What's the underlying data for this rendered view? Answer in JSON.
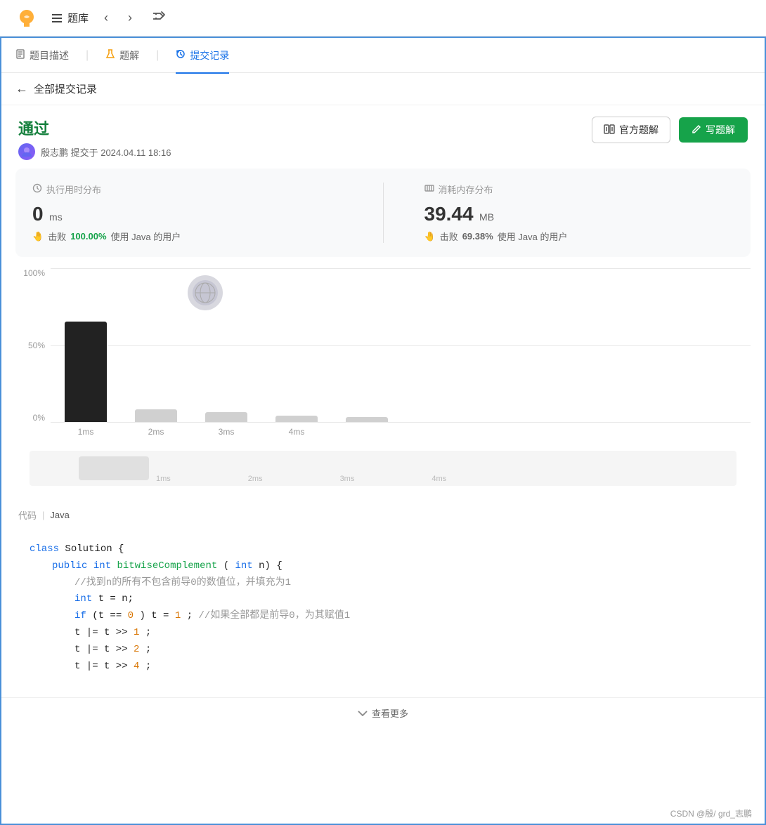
{
  "app": {
    "logo_alt": "LeetCode Logo"
  },
  "topnav": {
    "menu_icon_label": "≡",
    "title": "题库",
    "prev_label": "‹",
    "next_label": "›",
    "shuffle_label": "⇌"
  },
  "tabs": [
    {
      "id": "description",
      "label": "题目描述",
      "icon": "doc-icon",
      "active": false
    },
    {
      "id": "solution",
      "label": "题解",
      "icon": "flask-icon",
      "active": false
    },
    {
      "id": "submissions",
      "label": "提交记录",
      "icon": "history-icon",
      "active": true
    }
  ],
  "breadcrumb": {
    "back_label": "←",
    "text": "全部提交记录"
  },
  "submission": {
    "status": "通过",
    "user_avatar_alt": "user avatar",
    "user_info": "殷志鹏 提交于 2024.04.11 18:16",
    "btn_official_label": "官方题解",
    "btn_write_label": "写题解"
  },
  "stats": {
    "time_title": "执行用时分布",
    "time_value": "0",
    "time_unit": "ms",
    "time_beat_text": "击败",
    "time_beat_pct": "100.00%",
    "time_beat_suffix": "使用 Java 的用户",
    "memory_title": "消耗内存分布",
    "memory_value": "39.44",
    "memory_unit": "MB",
    "memory_beat_text": "击败",
    "memory_beat_pct": "69.38%",
    "memory_beat_suffix": "使用 Java 的用户"
  },
  "chart": {
    "y_labels": [
      "100%",
      "50%",
      "0%"
    ],
    "x_labels": [
      "1ms",
      "2ms",
      "3ms",
      "4ms"
    ],
    "bars": [
      {
        "height_pct": 65,
        "dark": true
      },
      {
        "height_pct": 8,
        "dark": false
      },
      {
        "height_pct": 6,
        "dark": false
      },
      {
        "height_pct": 4,
        "dark": false
      },
      {
        "height_pct": 3,
        "dark": false
      }
    ],
    "scrollbar_x_labels": [
      "1ms",
      "2ms",
      "3ms",
      "4ms"
    ]
  },
  "code": {
    "label": "代码",
    "lang": "Java",
    "lines": [
      {
        "indent": 0,
        "content": "class Solution {"
      },
      {
        "indent": 1,
        "content": "public int bitwiseComplement(int n) {"
      },
      {
        "indent": 2,
        "content": "//找到n的所有不包含前导0的数值位，并填充为1"
      },
      {
        "indent": 2,
        "content": "int t = n;"
      },
      {
        "indent": 2,
        "content": "if(t == 0) t = 1;//如果全部都是前导0，为其赋值1"
      },
      {
        "indent": 2,
        "content": "t |= t >> 1;"
      },
      {
        "indent": 2,
        "content": "t |= t >> 2;"
      },
      {
        "indent": 2,
        "content": "t |= t >> 4;"
      }
    ]
  },
  "show_more": {
    "label": "查看更多"
  },
  "footer": {
    "credit": "CSDN @殷/ grd_志鹏"
  }
}
